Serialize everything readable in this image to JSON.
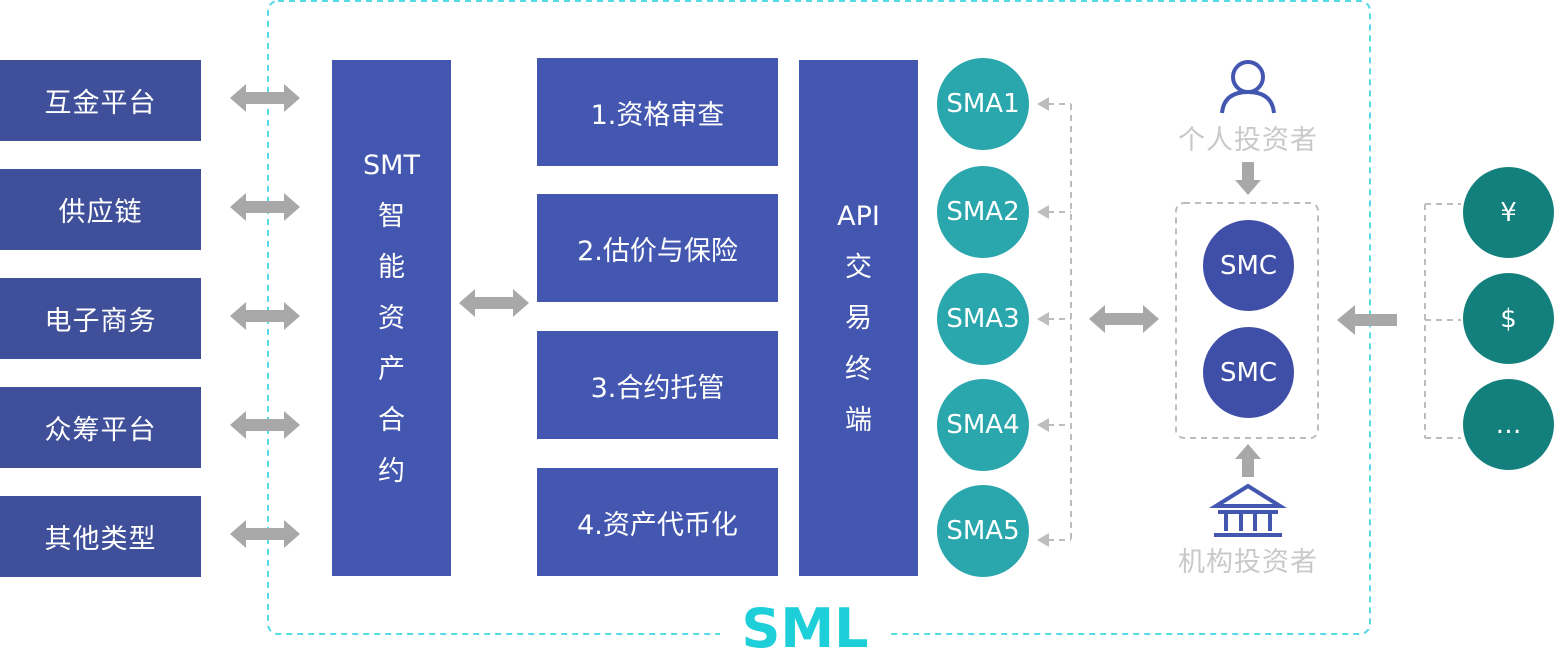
{
  "platforms": [
    "互金平台",
    "供应链",
    "电子商务",
    "众筹平台",
    "其他类型"
  ],
  "smart_contract": {
    "line1": "SMT",
    "chars": [
      "智",
      "能",
      "资",
      "产",
      "合",
      "约"
    ]
  },
  "steps": [
    "1.资格审查",
    "2.估价与保险",
    "3.合约托管",
    "4.资产代币化"
  ],
  "api_terminal": {
    "line1": "API",
    "chars": [
      "交",
      "易",
      "终",
      "端"
    ]
  },
  "sma_nodes": [
    "SMA1",
    "SMA2",
    "SMA3",
    "SMA4",
    "SMA5"
  ],
  "smc_nodes": [
    "SMC",
    "SMC"
  ],
  "investors": {
    "individual": "个人投资者",
    "institutional": "机构投资者"
  },
  "currencies": [
    "¥",
    "$",
    "…"
  ],
  "layer_title": "SML",
  "colors": {
    "navy_box": "#3f4f99",
    "blue_box": "#4457b0",
    "sma_teal": "#2aa6ad",
    "smc_blue": "#3f4fa8",
    "currency_teal": "#13807d",
    "sml_cyan": "#1ccfd8",
    "arrow_gray": "#a8a8a8"
  }
}
